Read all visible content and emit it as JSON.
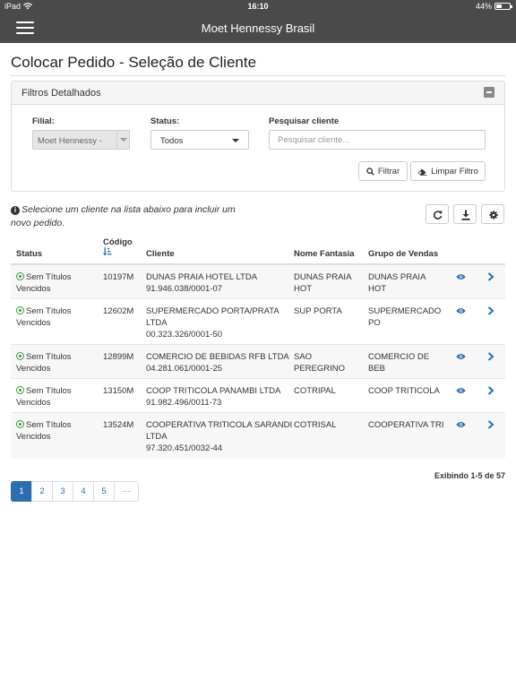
{
  "statusbar": {
    "device": "iPad",
    "time": "16:10",
    "battery": "44%",
    "battery_level": 0.44
  },
  "navbar": {
    "title": "Moet Hennessy Brasil",
    "menu_icon": "hamburger-icon"
  },
  "page": {
    "title": "Colocar Pedido - Seleção de Cliente"
  },
  "filters": {
    "panel_title": "Filtros Detalhados",
    "filial_label": "Filial:",
    "filial_value": "Moet Hennessy -",
    "status_label": "Status:",
    "status_value": "Todos",
    "search_label": "Pesquisar cliente",
    "search_placeholder": "Pesquisar cliente...",
    "search_value": "",
    "filter_button": "Filtrar",
    "clear_button": "Limpar Filtro"
  },
  "info": {
    "line1": "Selecione um cliente na lista abaixo para incluir um",
    "line2": "novo pedido."
  },
  "table": {
    "headers": {
      "status": "Status",
      "codigo": "Código",
      "cliente": "Cliente",
      "fantasia": "Nome Fantasia",
      "grupo": "Grupo de Vendas"
    },
    "rows": [
      {
        "status1": "Sem Títulos",
        "status2": "Vencidos",
        "codigo": "10197M",
        "cliente1": "DUNAS PRAIA HOTEL LTDA",
        "cliente2": "91.946.038/0001-07",
        "cliente3": "",
        "fantasia1": "DUNAS PRAIA",
        "fantasia2": "HOT",
        "grupo1": "DUNAS PRAIA",
        "grupo2": "HOT"
      },
      {
        "status1": "Sem Títulos",
        "status2": "Vencidos",
        "codigo": "12602M",
        "cliente1": "SUPERMERCADO PORTA/PRATA",
        "cliente2": "LTDA",
        "cliente3": "00.323.326/0001-50",
        "fantasia1": "SUP PORTA",
        "fantasia2": "",
        "grupo1": "SUPERMERCADO",
        "grupo2": "PO"
      },
      {
        "status1": "Sem Títulos",
        "status2": "Vencidos",
        "codigo": "12899M",
        "cliente1": "COMERCIO DE BEBIDAS RFB LTDA",
        "cliente2": "04.281.061/0001-25",
        "cliente3": "",
        "fantasia1": "SAO",
        "fantasia2": "PEREGRINO",
        "grupo1": "COMERCIO DE",
        "grupo2": "BEB"
      },
      {
        "status1": "Sem Títulos",
        "status2": "Vencidos",
        "codigo": "13150M",
        "cliente1": "COOP TRITICOLA PANAMBI LTDA",
        "cliente2": "91.982.496/0011-73",
        "cliente3": "",
        "fantasia1": "COTRIPAL",
        "fantasia2": "",
        "grupo1": "COOP TRITICOLA",
        "grupo2": ""
      },
      {
        "status1": "Sem Títulos",
        "status2": "Vencidos",
        "codigo": "13524M",
        "cliente1": "COOPERATIVA TRITICOLA SARANDI",
        "cliente2": "LTDA",
        "cliente3": "97.320.451/0032-44",
        "fantasia1": "COTRISAL",
        "fantasia2": "",
        "grupo1": "COOPERATIVA TRI",
        "grupo2": ""
      }
    ]
  },
  "pagination": {
    "summary": "Exibindo 1-5 de 57",
    "pages": [
      "1",
      "2",
      "3",
      "4",
      "5",
      "···"
    ],
    "active": "1"
  },
  "colors": {
    "navbar": "#4a4a4a",
    "accent": "#2a6fb0",
    "status_ok": "#3a9a3a"
  }
}
